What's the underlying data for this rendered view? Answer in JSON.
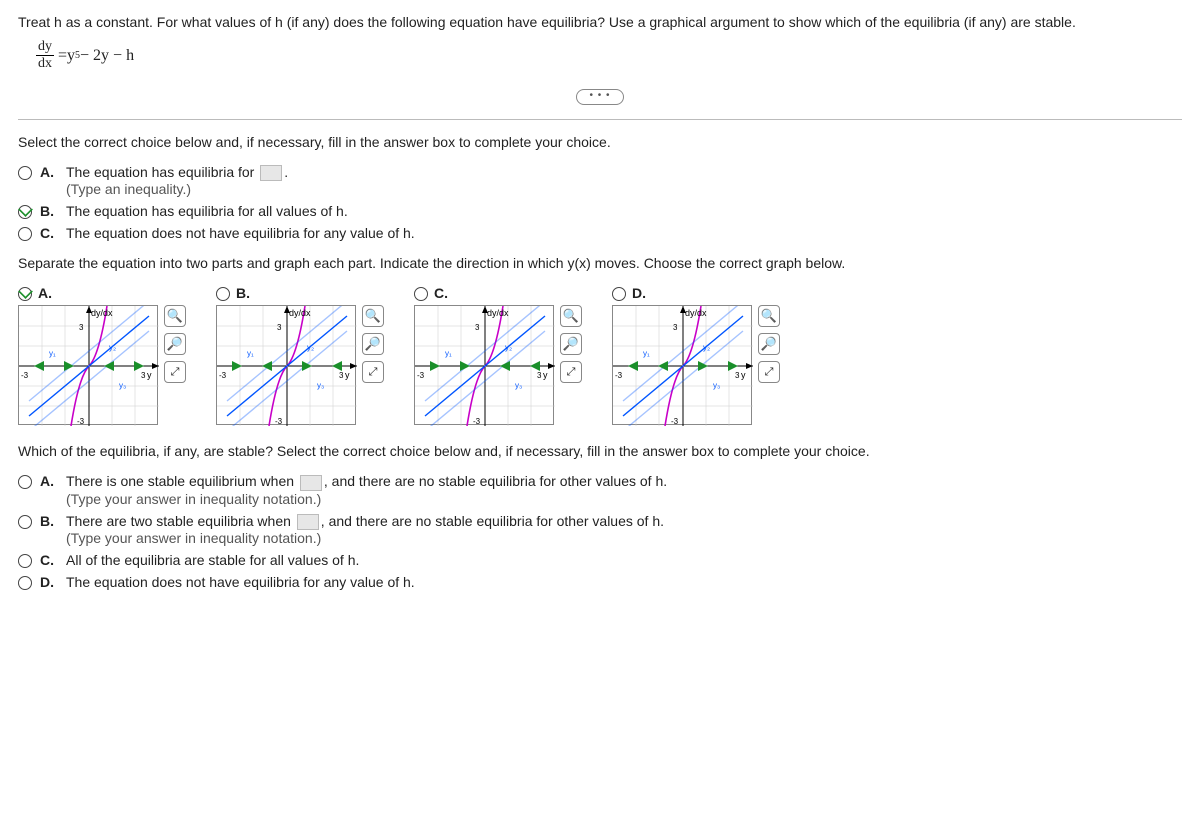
{
  "question": "Treat h as a constant. For what values of h (if any) does the following equation have equilibria? Use a graphical argument to show which of the equilibria (if any) are stable.",
  "equation": {
    "lhs_num": "dy",
    "lhs_den": "dx",
    "eq": " = ",
    "rhs": "y",
    "rhs_sup": "5",
    "rhs_tail": " − 2y − h"
  },
  "ellipsis": "• • •",
  "prompt1": "Select the correct choice below and, if necessary, fill in the answer box to complete your choice.",
  "q1": {
    "A": {
      "text_pre": "The equation has equilibria for ",
      "text_post": ".",
      "hint": "(Type an inequality.)"
    },
    "B": {
      "text": "The equation has equilibria for all values of h."
    },
    "C": {
      "text": "The equation does not have equilibria for any value of h."
    }
  },
  "prompt2": "Separate the equation into two parts and graph each part. Indicate the direction in which y(x) moves. Choose the correct graph below.",
  "graph_labels": {
    "A": "A.",
    "B": "B.",
    "C": "C.",
    "D": "D."
  },
  "axis": {
    "ylabel": "dy/dx",
    "xlabel": "y",
    "xmin": "-3",
    "xmax": "3",
    "ymax": "3",
    "ymin": "-3"
  },
  "curve_labels": {
    "y1": "y₁",
    "y2": "y₂",
    "y3": "y₃"
  },
  "prompt3": "Which of the equilibria, if any, are stable? Select the correct choice below and, if necessary, fill in the answer box to complete your choice.",
  "q3": {
    "A": {
      "pre": "There is one stable equilibrium when ",
      "post": ", and there are no stable equilibria for other values of h.",
      "hint": "(Type your answer in inequality notation.)"
    },
    "B": {
      "pre": "There are two stable equilibria when ",
      "post": ", and there are no stable equilibria for other values of h.",
      "hint": "(Type your answer in inequality notation.)"
    },
    "C": {
      "text": "All of the equilibria are stable for all values of h."
    },
    "D": {
      "text": "The equation does not have equilibria for any value of h."
    }
  }
}
